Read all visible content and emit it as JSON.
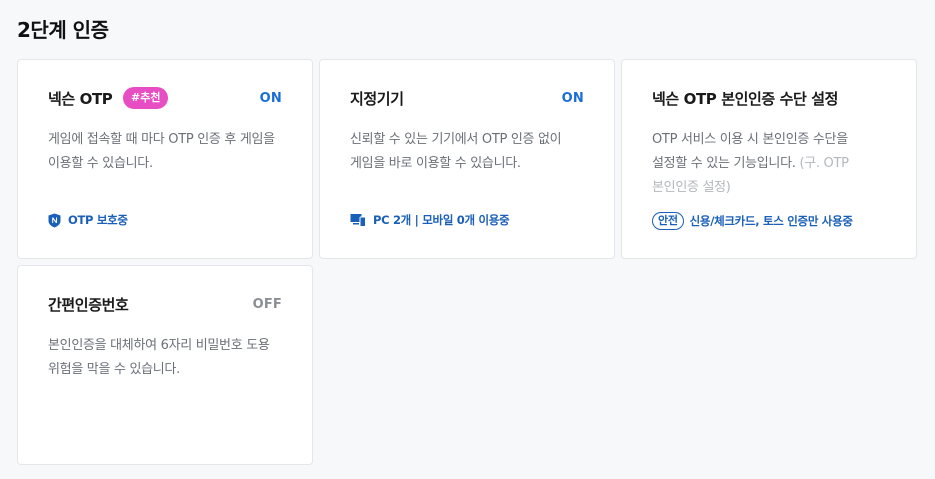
{
  "section": {
    "title": "2단계 인증"
  },
  "cards": [
    {
      "title": "넥슨 OTP",
      "badge": "#추천",
      "status": "ON",
      "desc_line1": "게임에 접속할 때 마다 OTP 인증 후 게임을",
      "desc_line2": "이용할 수 있습니다.",
      "footer_icon": "nexon-shield-icon",
      "footer_text": "OTP 보호중"
    },
    {
      "title": "지정기기",
      "status": "ON",
      "desc_line1": "신뢰할 수 있는 기기에서 OTP 인증 없이",
      "desc_line2": "게임을 바로 이용할 수 있습니다.",
      "footer_icon": "devices-icon",
      "footer_text": "PC 2개 | 모바일 0개 이용중"
    },
    {
      "title": "넥슨 OTP 본인인증 수단 설정",
      "desc_line1": "OTP 서비스 이용 시 본인인증 수단을",
      "desc_line2": "설정할 수 있는 기능입니다.",
      "desc_note_a": "(구. OTP",
      "desc_note_b": "본인인증 설정)",
      "footer_pill": "안전",
      "footer_text": "신용/체크카드, 토스 인증만 사용중"
    },
    {
      "title": "간편인증번호",
      "status": "OFF",
      "desc_line1": "본인인증을 대체하여 6자리 비밀번호 도용",
      "desc_line2": "위험을 막을 수 있습니다."
    }
  ],
  "colors": {
    "accent_blue": "#1a6fd6",
    "badge_pink": "#e84ec3",
    "off_gray": "#8a8f96"
  }
}
